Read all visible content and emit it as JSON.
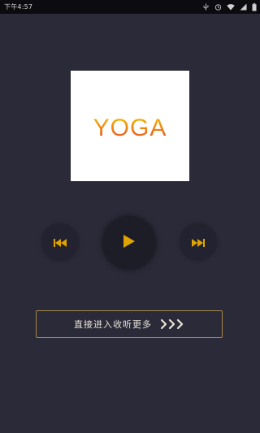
{
  "status_bar": {
    "time": "下午4:57",
    "icons": [
      "usb-icon",
      "alarm-icon",
      "wifi-icon",
      "signal-icon",
      "battery-icon"
    ]
  },
  "album": {
    "logo_text": "YOGA",
    "logo_gradient": [
      "#f5c400",
      "#e94a2a"
    ],
    "background": "#ffffff"
  },
  "controls": {
    "prev_icon": "skip-previous-icon",
    "play_icon": "play-icon",
    "next_icon": "skip-next-icon",
    "accent_color": "#e0a400"
  },
  "listen_button": {
    "label": "直接进入收听更多",
    "arrows_icon": "triple-chevron-right-icon"
  },
  "colors": {
    "background": "#2a2a39",
    "button_border": "#a8884a"
  }
}
